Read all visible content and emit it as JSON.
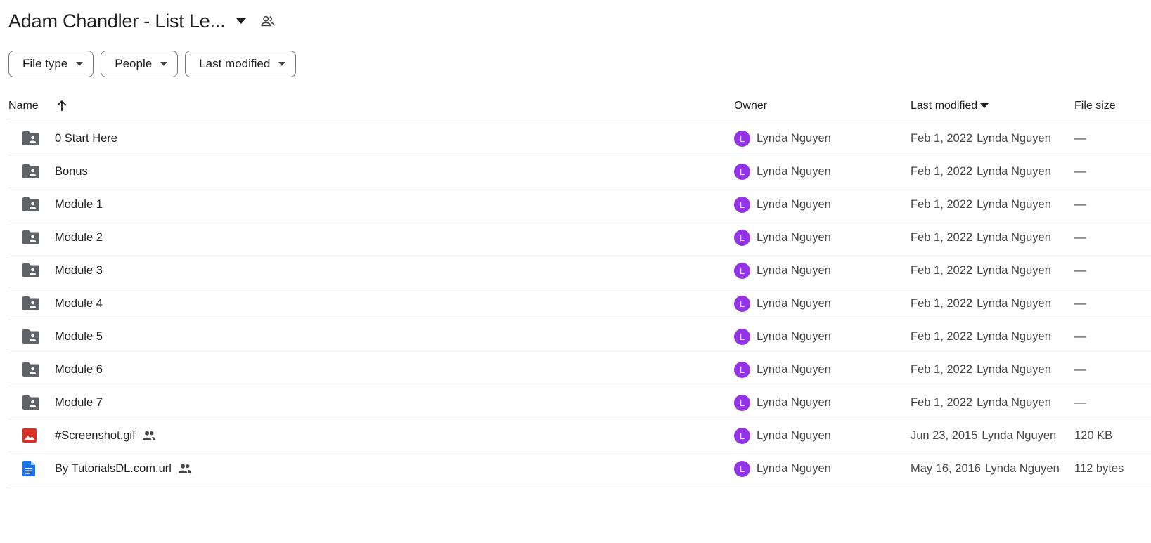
{
  "header": {
    "title": "Adam Chandler - List Le...",
    "title_caret_icon": "arrow-drop-down-icon",
    "share_icon": "people-outline-icon"
  },
  "filters": [
    {
      "label": "File type"
    },
    {
      "label": "People"
    },
    {
      "label": "Last modified"
    }
  ],
  "columns": {
    "name": "Name",
    "owner": "Owner",
    "last_modified": "Last modified",
    "file_size": "File size"
  },
  "colors": {
    "folder": "#5f6368",
    "image_file": "#d93025",
    "doc_file": "#1a73e8",
    "avatar": "#9334e6"
  },
  "rows": [
    {
      "type": "folder",
      "icon": "shared-folder-icon",
      "name": "0 Start Here",
      "shared": false,
      "owner_initial": "L",
      "owner": "Lynda Nguyen",
      "modified_date": "Feb 1, 2022",
      "modified_by": "Lynda Nguyen",
      "size": "—"
    },
    {
      "type": "folder",
      "icon": "shared-folder-icon",
      "name": "Bonus",
      "shared": false,
      "owner_initial": "L",
      "owner": "Lynda Nguyen",
      "modified_date": "Feb 1, 2022",
      "modified_by": "Lynda Nguyen",
      "size": "—"
    },
    {
      "type": "folder",
      "icon": "shared-folder-icon",
      "name": "Module 1",
      "shared": false,
      "owner_initial": "L",
      "owner": "Lynda Nguyen",
      "modified_date": "Feb 1, 2022",
      "modified_by": "Lynda Nguyen",
      "size": "—"
    },
    {
      "type": "folder",
      "icon": "shared-folder-icon",
      "name": "Module 2",
      "shared": false,
      "owner_initial": "L",
      "owner": "Lynda Nguyen",
      "modified_date": "Feb 1, 2022",
      "modified_by": "Lynda Nguyen",
      "size": "—"
    },
    {
      "type": "folder",
      "icon": "shared-folder-icon",
      "name": "Module 3",
      "shared": false,
      "owner_initial": "L",
      "owner": "Lynda Nguyen",
      "modified_date": "Feb 1, 2022",
      "modified_by": "Lynda Nguyen",
      "size": "—"
    },
    {
      "type": "folder",
      "icon": "shared-folder-icon",
      "name": "Module 4",
      "shared": false,
      "owner_initial": "L",
      "owner": "Lynda Nguyen",
      "modified_date": "Feb 1, 2022",
      "modified_by": "Lynda Nguyen",
      "size": "—"
    },
    {
      "type": "folder",
      "icon": "shared-folder-icon",
      "name": "Module 5",
      "shared": false,
      "owner_initial": "L",
      "owner": "Lynda Nguyen",
      "modified_date": "Feb 1, 2022",
      "modified_by": "Lynda Nguyen",
      "size": "—"
    },
    {
      "type": "folder",
      "icon": "shared-folder-icon",
      "name": "Module 6",
      "shared": false,
      "owner_initial": "L",
      "owner": "Lynda Nguyen",
      "modified_date": "Feb 1, 2022",
      "modified_by": "Lynda Nguyen",
      "size": "—"
    },
    {
      "type": "folder",
      "icon": "shared-folder-icon",
      "name": "Module 7",
      "shared": false,
      "owner_initial": "L",
      "owner": "Lynda Nguyen",
      "modified_date": "Feb 1, 2022",
      "modified_by": "Lynda Nguyen",
      "size": "—"
    },
    {
      "type": "image",
      "icon": "image-file-icon",
      "name": "#Screenshot.gif",
      "shared": true,
      "owner_initial": "L",
      "owner": "Lynda Nguyen",
      "modified_date": "Jun 23, 2015",
      "modified_by": "Lynda Nguyen",
      "size": "120 KB"
    },
    {
      "type": "doc",
      "icon": "document-file-icon",
      "name": "By TutorialsDL.com.url",
      "shared": true,
      "owner_initial": "L",
      "owner": "Lynda Nguyen",
      "modified_date": "May 16, 2016",
      "modified_by": "Lynda Nguyen",
      "size": "112 bytes"
    }
  ]
}
